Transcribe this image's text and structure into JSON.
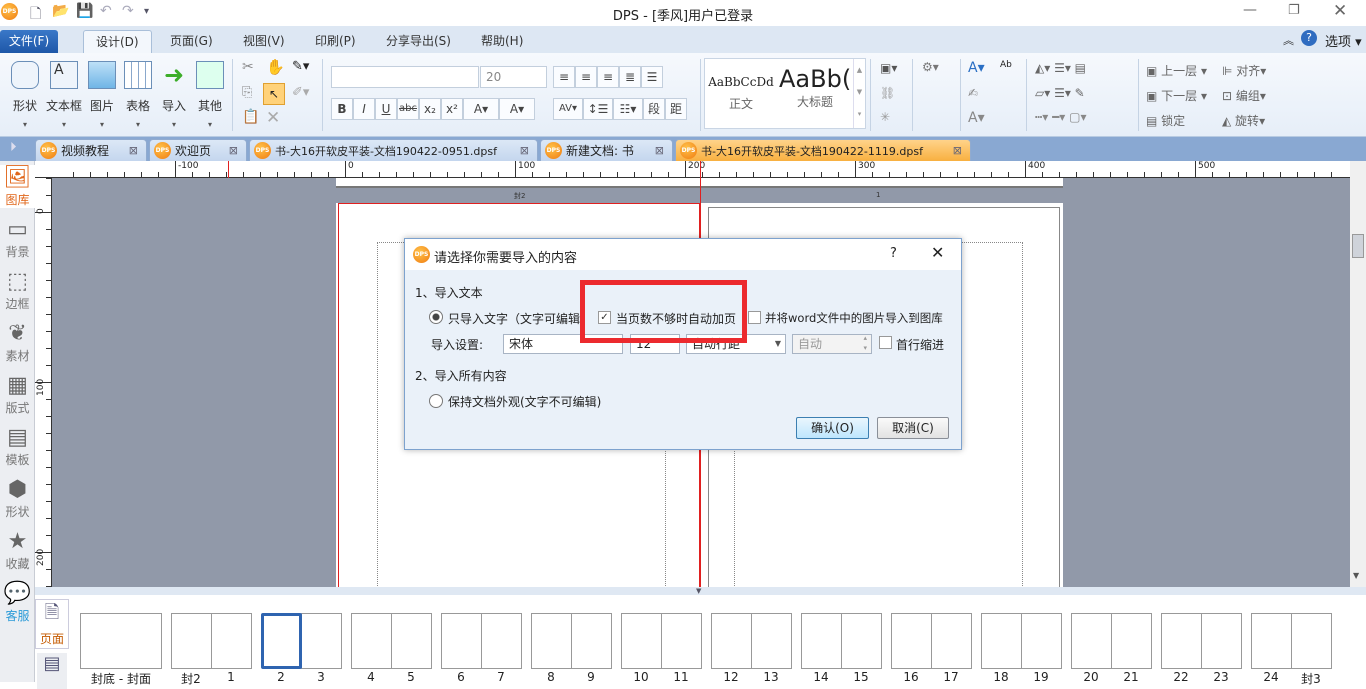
{
  "title_bar": {
    "title": "DPS - [季风]用户已登录",
    "logo": "DPS",
    "quick_access": [
      "new-file-icon",
      "open-folder-icon",
      "save-icon",
      "undo-icon",
      "redo-icon",
      "customize-icon"
    ],
    "controls": [
      "minimize-icon",
      "restore-icon",
      "close-icon"
    ]
  },
  "menu": {
    "tabs": [
      {
        "label": "文件(F)"
      },
      {
        "label": "设计(D)"
      },
      {
        "label": "页面(G)"
      },
      {
        "label": "视图(V)"
      },
      {
        "label": "印刷(P)"
      },
      {
        "label": "分享导出(S)"
      },
      {
        "label": "帮助(H)"
      }
    ],
    "active_tab": "设计(D)",
    "options_label": "选项"
  },
  "ribbon": {
    "insert_items": [
      {
        "label": "形状"
      },
      {
        "label": "文本框"
      },
      {
        "label": "图片"
      },
      {
        "label": "表格"
      },
      {
        "label": "导入"
      },
      {
        "label": "其他"
      }
    ],
    "font_name": "",
    "font_size": "20",
    "styles": [
      {
        "preview": "AaBbCcDd",
        "label": "正文"
      },
      {
        "preview": "AaBb(",
        "label": "大标题"
      }
    ],
    "arrange": [
      {
        "label": "上一层"
      },
      {
        "label": "对齐"
      },
      {
        "label": "下一层"
      },
      {
        "label": "编组"
      },
      {
        "label": "锁定"
      },
      {
        "label": "旋转"
      }
    ]
  },
  "doc_tabs": [
    {
      "label": "视频教程"
    },
    {
      "label": "欢迎页"
    },
    {
      "label": "书-大16开软皮平装-文档190422-0951.dpsf"
    },
    {
      "label": "新建文档: 书"
    },
    {
      "label": "书-大16开软皮平装-文档190422-1119.dpsf",
      "active": true
    }
  ],
  "left_panel": [
    {
      "label": "图库",
      "icon": "gallery-icon",
      "active": true
    },
    {
      "label": "背景",
      "icon": "background-icon"
    },
    {
      "label": "边框",
      "icon": "border-icon"
    },
    {
      "label": "素材",
      "icon": "material-icon"
    },
    {
      "label": "版式",
      "icon": "layout-icon"
    },
    {
      "label": "模板",
      "icon": "template-icon"
    },
    {
      "label": "形状",
      "icon": "shape-icon"
    },
    {
      "label": "收藏",
      "icon": "star-icon"
    },
    {
      "label": "客服",
      "icon": "chat-icon"
    }
  ],
  "rulers": {
    "horizontal": [
      "-100",
      "0",
      "100",
      "200",
      "300",
      "400",
      "500"
    ],
    "vertical": [
      "0",
      "100",
      "200"
    ]
  },
  "page_markers": {
    "left": "封2",
    "right": "1"
  },
  "dialog": {
    "title": "请选择你需要导入的内容",
    "help": "?",
    "section1": "1、导入文本",
    "option_text_only": "只导入文字（文字可编辑）",
    "auto_add_pages": {
      "label": "当页数不够时自动加页",
      "checked": true
    },
    "import_images": {
      "label": "并将word文件中的图片导入到图库",
      "checked": false
    },
    "settings_label": "导入设置:",
    "font": "宋体",
    "size": "12",
    "line_spacing": "自动行距",
    "spacing_value": "自动",
    "first_line_indent": {
      "label": "首行缩进",
      "checked": false
    },
    "section2": "2、导入所有内容",
    "option_keep_layout": "保持文档外观(文字不可编辑)",
    "selected_option": "text_only",
    "ok": "确认(O)",
    "cancel": "取消(C)",
    "highlight_color": "#ec2a2e"
  },
  "page_strip": {
    "tab_label": "页面",
    "spreads": [
      {
        "labels": [
          "封底 - 封面"
        ]
      },
      {
        "labels": [
          "封2",
          "1"
        ]
      },
      {
        "labels": [
          "2",
          "3"
        ],
        "selected": "2"
      },
      {
        "labels": [
          "4",
          "5"
        ]
      },
      {
        "labels": [
          "6",
          "7"
        ]
      },
      {
        "labels": [
          "8",
          "9"
        ]
      },
      {
        "labels": [
          "10",
          "11"
        ]
      },
      {
        "labels": [
          "12",
          "13"
        ]
      },
      {
        "labels": [
          "14",
          "15"
        ]
      },
      {
        "labels": [
          "16",
          "17"
        ]
      },
      {
        "labels": [
          "18",
          "19"
        ]
      },
      {
        "labels": [
          "20",
          "21"
        ]
      },
      {
        "labels": [
          "22",
          "23"
        ]
      },
      {
        "labels": [
          "24",
          "封3"
        ]
      }
    ]
  }
}
